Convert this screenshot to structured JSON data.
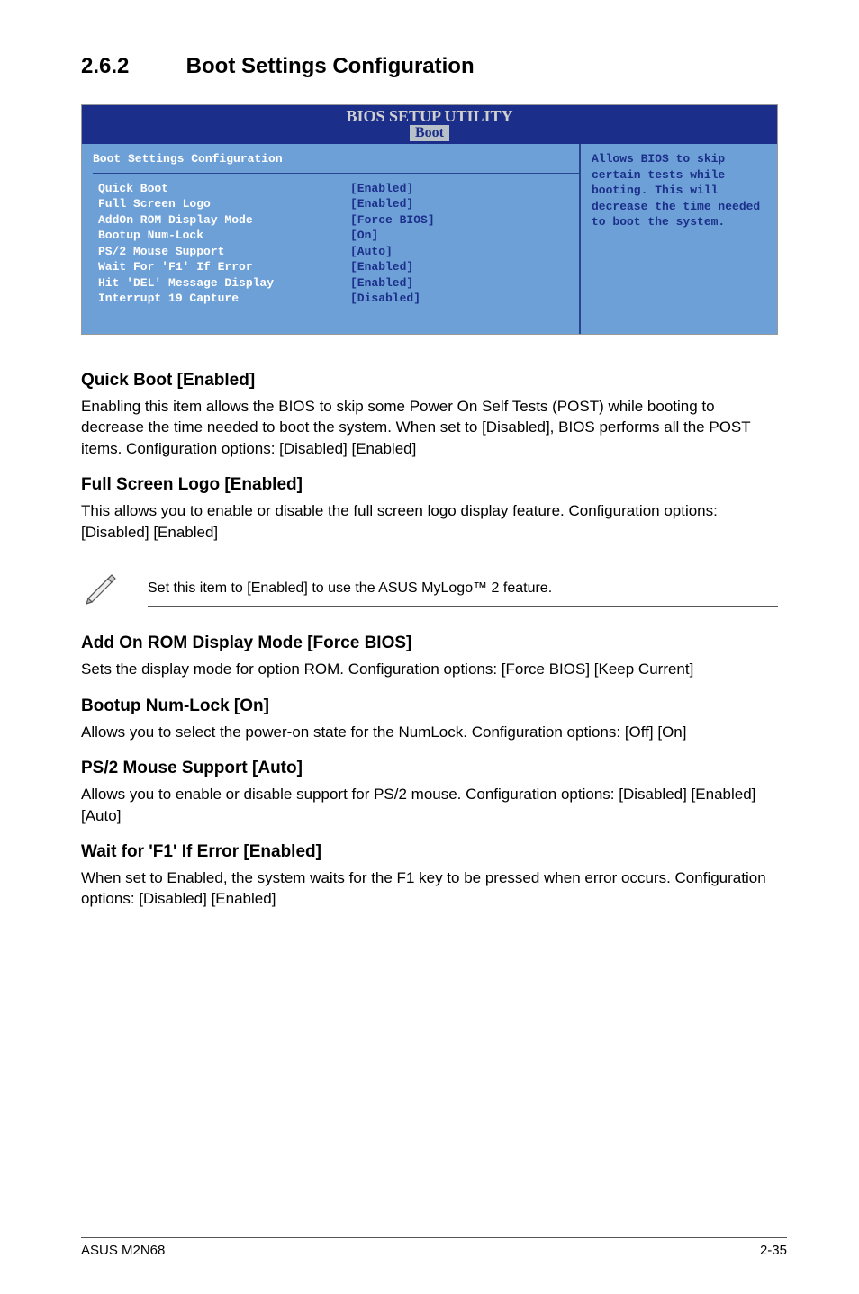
{
  "section": {
    "number": "2.6.2",
    "title": "Boot Settings Configuration"
  },
  "bios": {
    "title": "BIOS SETUP UTILITY",
    "tab": "Boot",
    "panel_heading": "Boot Settings Configuration",
    "rows": [
      {
        "label": "Quick Boot",
        "value": "[Enabled]"
      },
      {
        "label": "Full Screen Logo",
        "value": "[Enabled]"
      },
      {
        "label": "AddOn ROM Display Mode",
        "value": "[Force BIOS]"
      },
      {
        "label": "Bootup Num-Lock",
        "value": "[On]"
      },
      {
        "label": "PS/2 Mouse Support",
        "value": "[Auto]"
      },
      {
        "label": "Wait For 'F1' If Error",
        "value": "[Enabled]"
      },
      {
        "label": "Hit 'DEL' Message Display",
        "value": "[Enabled]"
      },
      {
        "label": "Interrupt 19 Capture",
        "value": "[Disabled]"
      }
    ],
    "help": "Allows BIOS to skip certain tests while booting. This will decrease the time needed to boot the system."
  },
  "items": {
    "quick_boot": {
      "heading": "Quick Boot [Enabled]",
      "text": "Enabling this item allows the BIOS to skip some Power On Self Tests (POST) while booting to decrease the time needed to boot the system. When set to [Disabled], BIOS performs all the POST items. Configuration options: [Disabled] [Enabled]"
    },
    "full_screen_logo": {
      "heading": "Full Screen Logo [Enabled]",
      "text": "This allows you to enable or disable the full screen logo display feature. Configuration options: [Disabled] [Enabled]"
    },
    "note": {
      "text": "Set this item to [Enabled] to use the ASUS MyLogo™ 2 feature."
    },
    "addon_rom": {
      "heading": "Add On ROM Display Mode [Force BIOS]",
      "text": "Sets the display mode for option ROM.  Configuration options: [Force BIOS] [Keep Current]"
    },
    "numlock": {
      "heading": "Bootup Num-Lock [On]",
      "text": "Allows you to select the power-on state for the NumLock. Configuration options: [Off] [On]"
    },
    "ps2": {
      "heading": "PS/2 Mouse Support [Auto]",
      "text": "Allows you to enable or disable support for PS/2 mouse. Configuration options: [Disabled] [Enabled] [Auto]"
    },
    "wait_f1": {
      "heading": "Wait for 'F1' If Error [Enabled]",
      "text": "When set to Enabled, the system waits for the F1 key to be pressed when error occurs. Configuration options: [Disabled] [Enabled]"
    }
  },
  "footer": {
    "left": "ASUS M2N68",
    "right": "2-35"
  }
}
